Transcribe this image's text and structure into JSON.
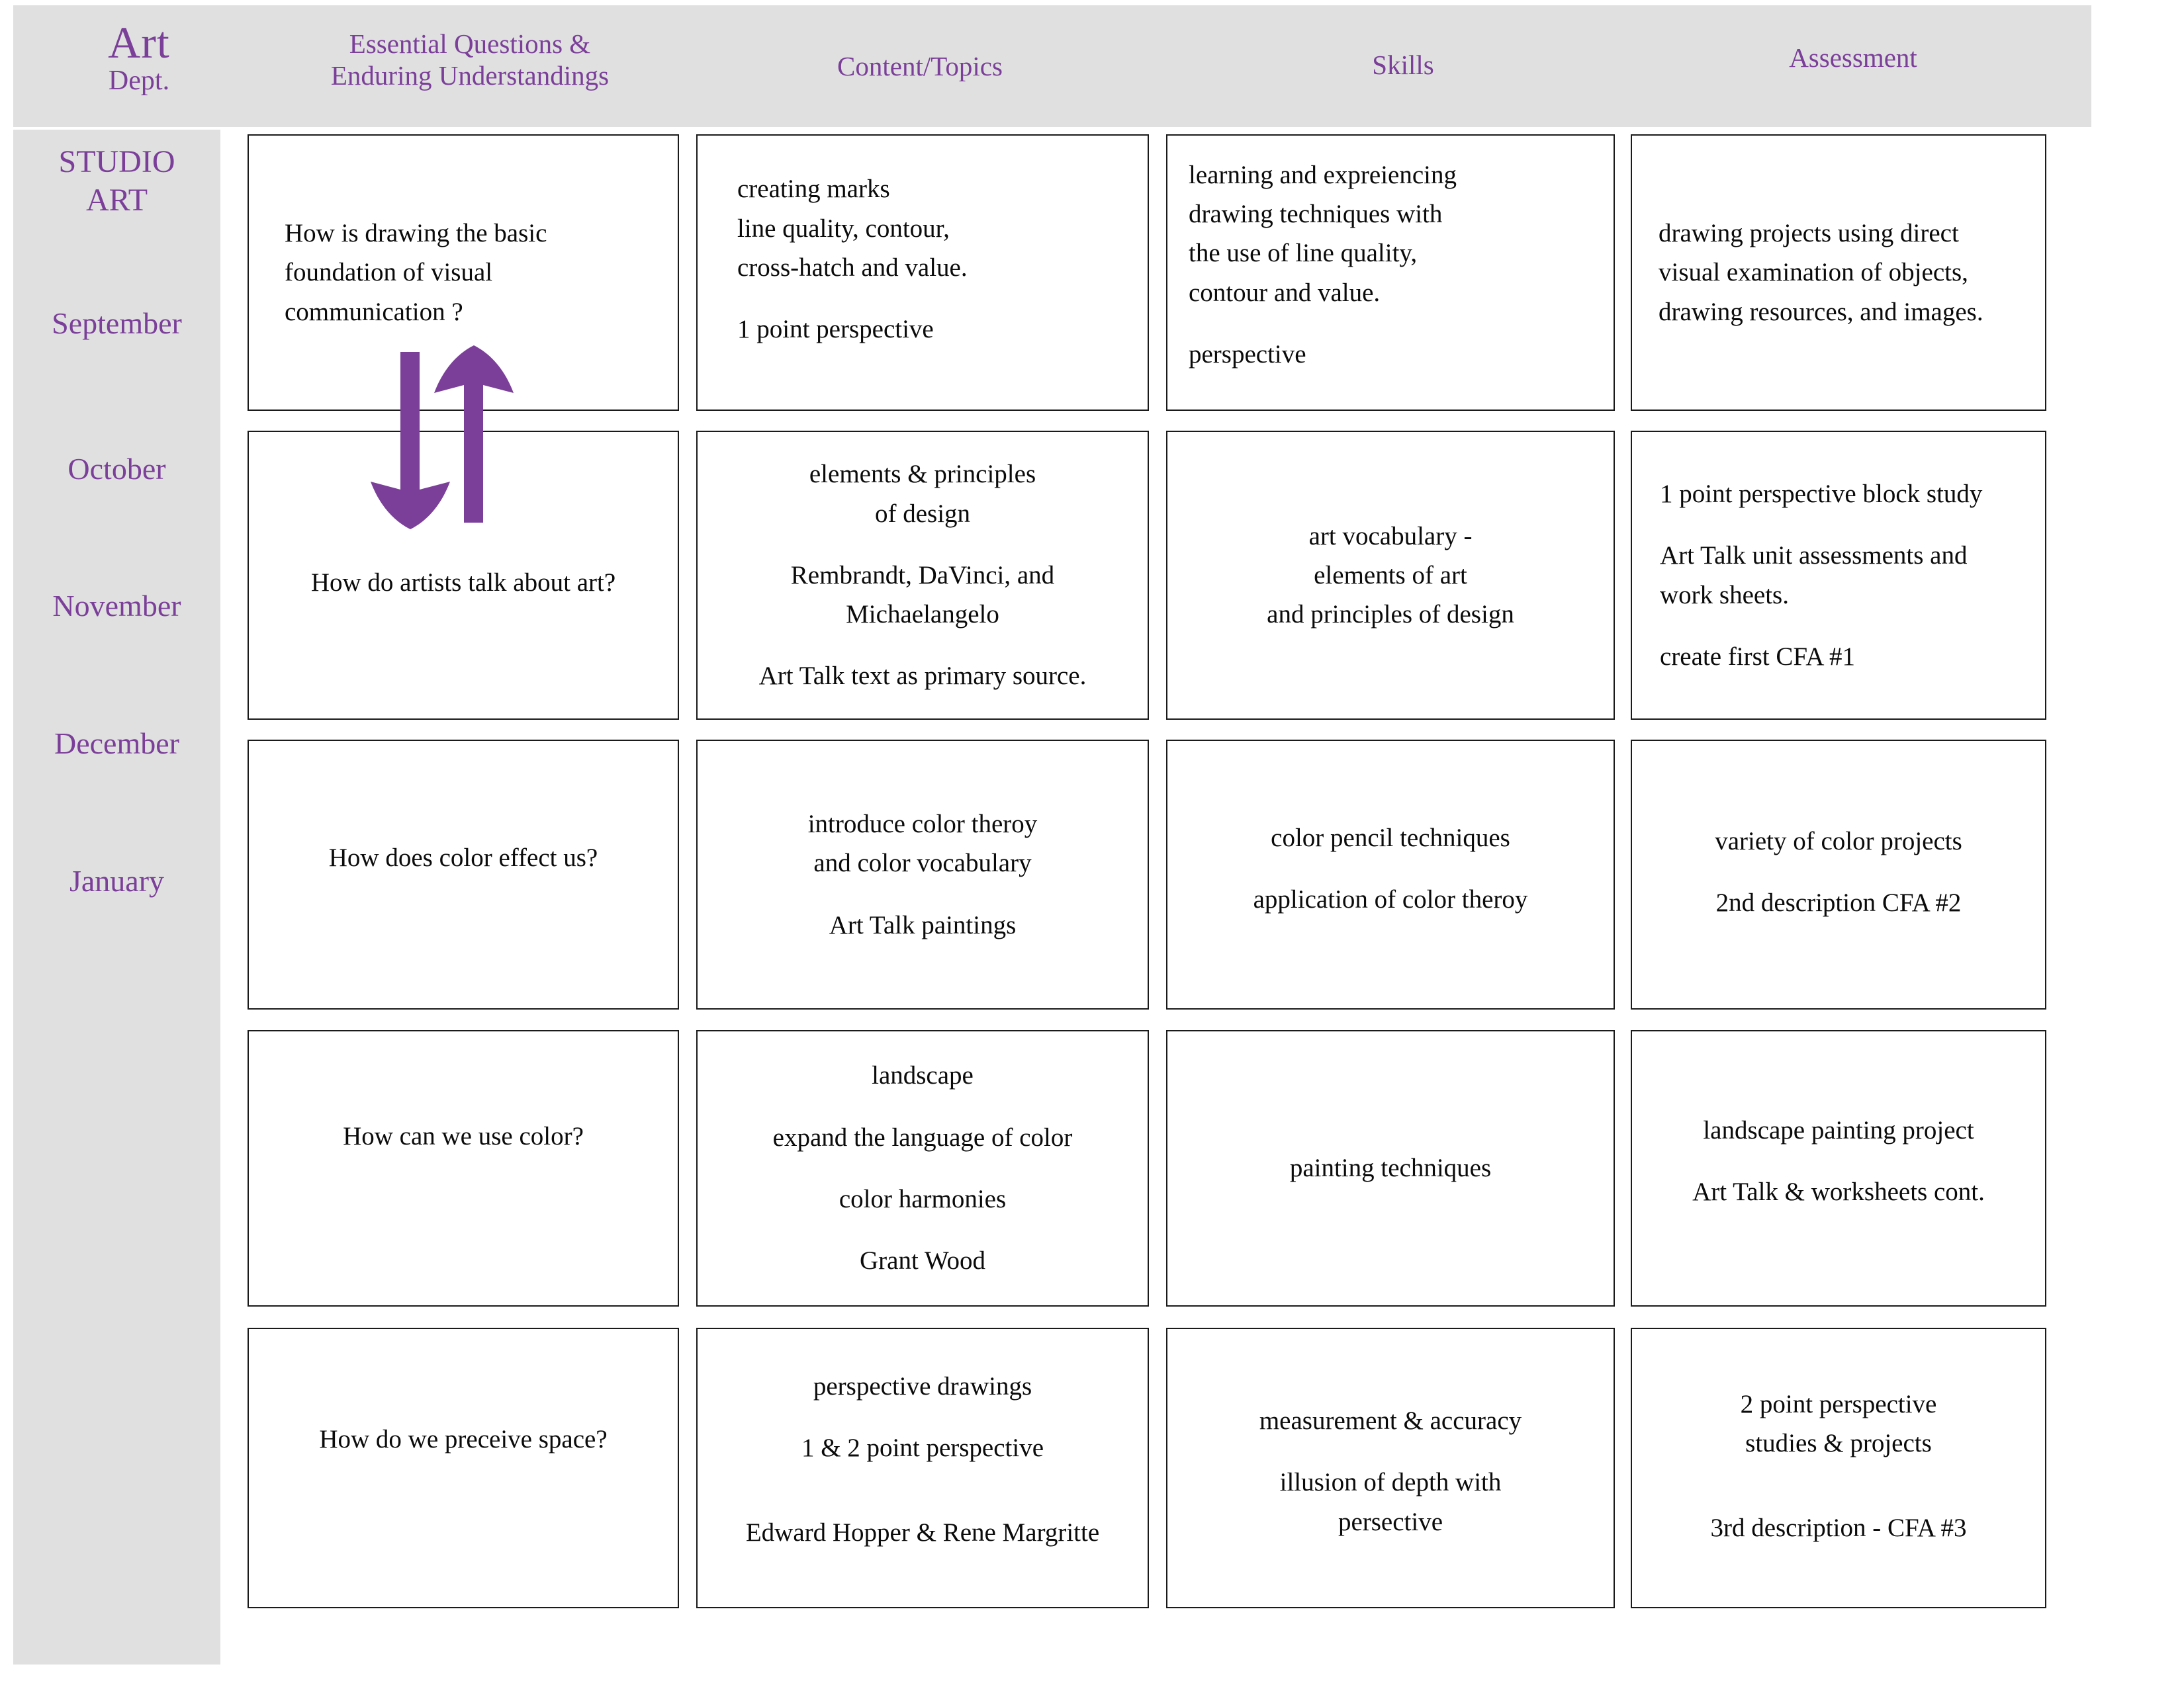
{
  "header": {
    "dept_title": "Art",
    "dept_sub": "Dept.",
    "columns": [
      {
        "label": "Essential Questions &\nEnduring Understandings"
      },
      {
        "label": "Content/Topics"
      },
      {
        "label": "Skills"
      },
      {
        "label": "Assessment"
      }
    ],
    "accent_color": "#7b3f99",
    "band_color": "#e0e0e0"
  },
  "sidebar": {
    "course": "STUDIO\nART",
    "months": [
      "September",
      "October",
      "November",
      "December",
      "January"
    ]
  },
  "rows": [
    {
      "month": "September",
      "essential_question": [
        "How is drawing the basic",
        "foundation of visual",
        "communication ?"
      ],
      "content": [
        "creating marks",
        "line quality, contour,",
        "cross-hatch and value.",
        "",
        "1 point perspective"
      ],
      "skills": [
        "learning and expreiencing",
        "drawing techniques with",
        "the  use of line quality,",
        "contour and value.",
        "",
        " perspective"
      ],
      "assessment": [
        "drawing projects using direct",
        "visual examination of objects,",
        "drawing resources, and images."
      ]
    },
    {
      "month": "October",
      "essential_question": [
        "How do artists talk about art?"
      ],
      "content": [
        "elements & principles",
        "of design",
        "",
        "Rembrandt, DaVinci,  and",
        "Michaelangelo",
        "",
        "Art Talk text as primary source."
      ],
      "skills": [
        " art vocabulary -",
        "elements of art",
        "and principles of design"
      ],
      "assessment": [
        "1 point perspective block study",
        "",
        "Art Talk unit assessments and",
        "work sheets.",
        "",
        "create first  CFA #1"
      ]
    },
    {
      "month": "November",
      "essential_question": [
        "How does color effect us?"
      ],
      "content": [
        "introduce color theroy",
        "and color vocabulary",
        "",
        "Art Talk paintings"
      ],
      "skills": [
        "color pencil techniques",
        "",
        "application of color theroy"
      ],
      "assessment": [
        "variety of color projects",
        "",
        "2nd description CFA #2"
      ]
    },
    {
      "month": "December",
      "essential_question": [
        "How can we use color?"
      ],
      "content": [
        "landscape",
        "",
        "expand the language of color",
        "",
        "color harmonies",
        "",
        "Grant Wood"
      ],
      "skills": [
        "painting techniques"
      ],
      "assessment": [
        "landscape painting project",
        "",
        "Art Talk & worksheets cont."
      ]
    },
    {
      "month": "January",
      "essential_question": [
        "How do we preceive space?"
      ],
      "content": [
        "perspective drawings",
        "",
        "1 & 2 point perspective",
        "",
        "",
        "Edward Hopper & Rene Margritte"
      ],
      "skills": [
        "measurement & accuracy",
        "",
        "illusion of depth with",
        "persective"
      ],
      "assessment": [
        "2 point perspective",
        "studies & projects",
        "",
        "",
        "3rd description  - CFA #3"
      ]
    }
  ],
  "annotations": {
    "arrow_down_name": "arrow-down",
    "arrow_up_name": "arrow-up",
    "arrow_color": "#7b3f99"
  }
}
